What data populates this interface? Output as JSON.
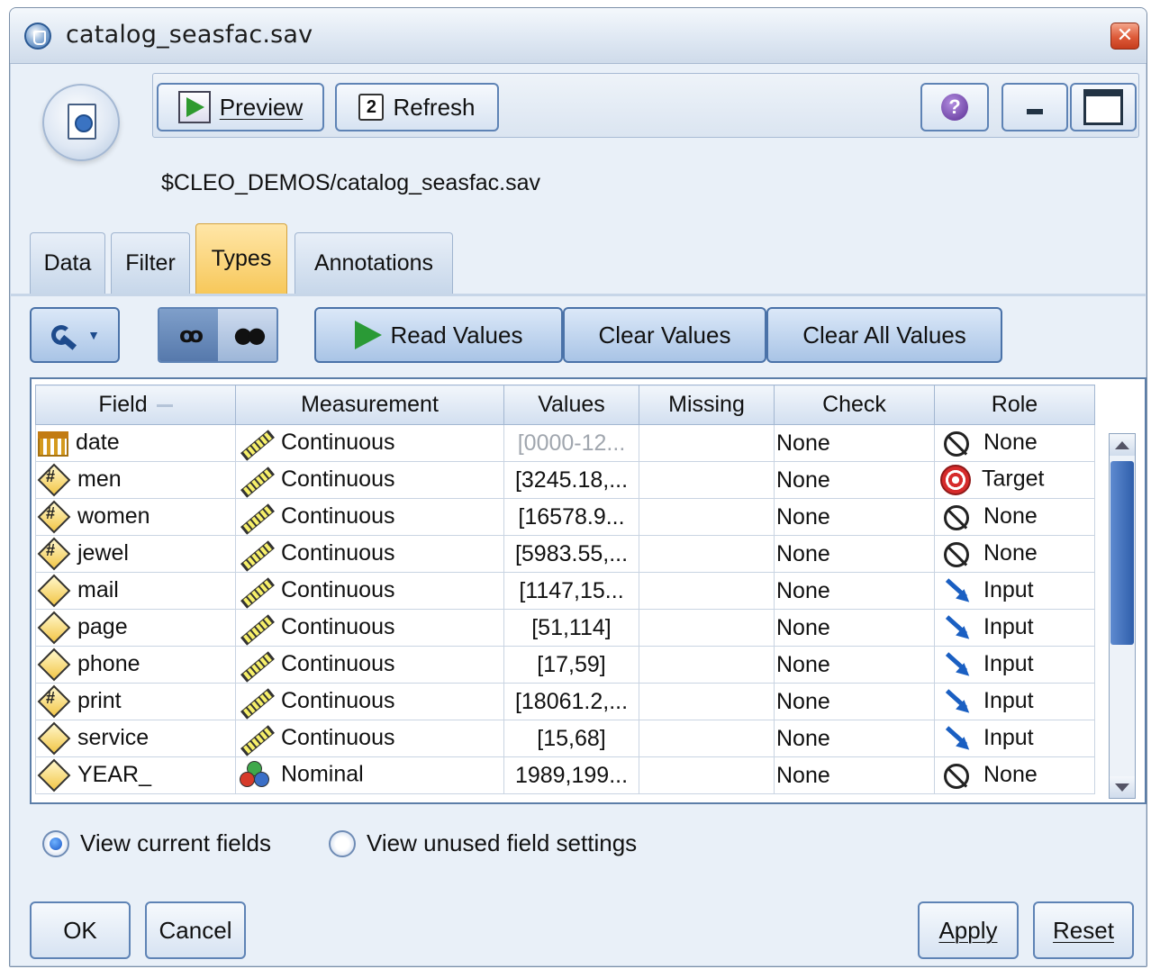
{
  "window": {
    "title": "catalog_seasfac.sav"
  },
  "toolbar": {
    "preview_label": "Preview",
    "refresh_label": "Refresh",
    "help_glyph": "?"
  },
  "source_path": "$CLEO_DEMOS/catalog_seasfac.sav",
  "tabs": [
    {
      "label": "Data",
      "active": false
    },
    {
      "label": "Filter",
      "active": false
    },
    {
      "label": "Types",
      "active": true
    },
    {
      "label": "Annotations",
      "active": false
    }
  ],
  "actions": {
    "read_values": "Read Values",
    "clear_values": "Clear Values",
    "clear_all_values": "Clear All Values"
  },
  "grid": {
    "columns": [
      "Field",
      "Measurement",
      "Values",
      "Missing",
      "Check",
      "Role"
    ],
    "rows": [
      {
        "field": "date",
        "field_icon": "calendar-icon",
        "measurement": "Continuous",
        "measurement_icon": "ruler-icon",
        "values": "[0000-12...",
        "values_muted": true,
        "missing": "",
        "check": "None",
        "role": "None",
        "role_icon": "none-icon"
      },
      {
        "field": "men",
        "field_icon": "real-number-icon",
        "measurement": "Continuous",
        "measurement_icon": "ruler-icon",
        "values": "[3245.18,...",
        "values_muted": false,
        "missing": "",
        "check": "None",
        "role": "Target",
        "role_icon": "target-icon"
      },
      {
        "field": "women",
        "field_icon": "real-number-icon",
        "measurement": "Continuous",
        "measurement_icon": "ruler-icon",
        "values": "[16578.9...",
        "values_muted": false,
        "missing": "",
        "check": "None",
        "role": "None",
        "role_icon": "none-icon"
      },
      {
        "field": "jewel",
        "field_icon": "real-number-icon",
        "measurement": "Continuous",
        "measurement_icon": "ruler-icon",
        "values": "[5983.55,...",
        "values_muted": false,
        "missing": "",
        "check": "None",
        "role": "None",
        "role_icon": "none-icon"
      },
      {
        "field": "mail",
        "field_icon": "integer-icon",
        "measurement": "Continuous",
        "measurement_icon": "ruler-icon",
        "values": "[1147,15...",
        "values_muted": false,
        "missing": "",
        "check": "None",
        "role": "Input",
        "role_icon": "input-arrow-icon"
      },
      {
        "field": "page",
        "field_icon": "integer-icon",
        "measurement": "Continuous",
        "measurement_icon": "ruler-icon",
        "values": "[51,114]",
        "values_muted": false,
        "missing": "",
        "check": "None",
        "role": "Input",
        "role_icon": "input-arrow-icon"
      },
      {
        "field": "phone",
        "field_icon": "integer-icon",
        "measurement": "Continuous",
        "measurement_icon": "ruler-icon",
        "values": "[17,59]",
        "values_muted": false,
        "missing": "",
        "check": "None",
        "role": "Input",
        "role_icon": "input-arrow-icon"
      },
      {
        "field": "print",
        "field_icon": "real-number-icon",
        "measurement": "Continuous",
        "measurement_icon": "ruler-icon",
        "values": "[18061.2,...",
        "values_muted": false,
        "missing": "",
        "check": "None",
        "role": "Input",
        "role_icon": "input-arrow-icon"
      },
      {
        "field": "service",
        "field_icon": "integer-icon",
        "measurement": "Continuous",
        "measurement_icon": "ruler-icon",
        "values": "[15,68]",
        "values_muted": false,
        "missing": "",
        "check": "None",
        "role": "Input",
        "role_icon": "input-arrow-icon"
      },
      {
        "field": "YEAR_",
        "field_icon": "integer-icon",
        "measurement": "Nominal",
        "measurement_icon": "nominal-icon",
        "values": "1989,199...",
        "values_muted": false,
        "missing": "",
        "check": "None",
        "role": "None",
        "role_icon": "none-icon"
      }
    ]
  },
  "view_options": {
    "current_fields": "View current fields",
    "unused_settings": "View unused field settings",
    "selected": "current_fields"
  },
  "buttons": {
    "ok": "OK",
    "cancel": "Cancel",
    "apply": "Apply",
    "reset": "Reset"
  },
  "colors": {
    "active_tab": "#f7c85a",
    "target_red": "#d62b2b",
    "input_blue": "#1a5fc2"
  }
}
